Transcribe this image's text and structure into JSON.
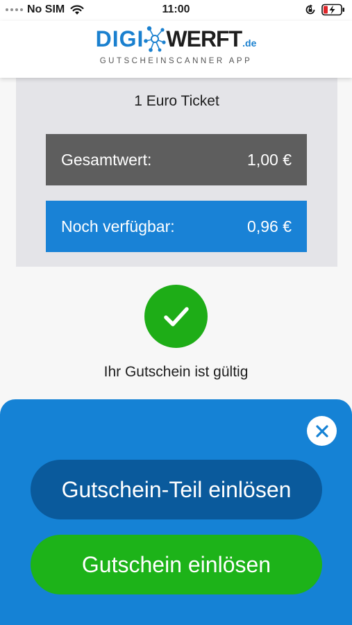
{
  "status_bar": {
    "carrier": "No SIM",
    "time": "11:00"
  },
  "header": {
    "logo_left": "DIGI",
    "logo_right": "WERFT",
    "logo_tld": ".de",
    "subtitle": "GUTSCHEINSCANNER APP"
  },
  "voucher": {
    "name": "1 Euro Ticket",
    "total_label": "Gesamtwert:",
    "total_value": "1,00 €",
    "available_label": "Noch verfügbar:",
    "available_value": "0,96 €"
  },
  "validity": {
    "message": "Ihr Gutschein ist gültig"
  },
  "actions": {
    "partial_redeem_label": "Gutschein-Teil einlösen",
    "redeem_label": "Gutschein einlösen"
  },
  "colors": {
    "brand_blue": "#1a80cf",
    "sheet_blue": "#1582d5",
    "dark_button": "#0a5a9c",
    "success_green": "#1db319",
    "total_gray": "#5e5e5e"
  },
  "icons": {
    "wifi": "wifi-icon",
    "rotation_lock": "rotation-lock-icon",
    "battery": "battery-charging-icon",
    "check": "check-icon",
    "close": "close-icon"
  }
}
